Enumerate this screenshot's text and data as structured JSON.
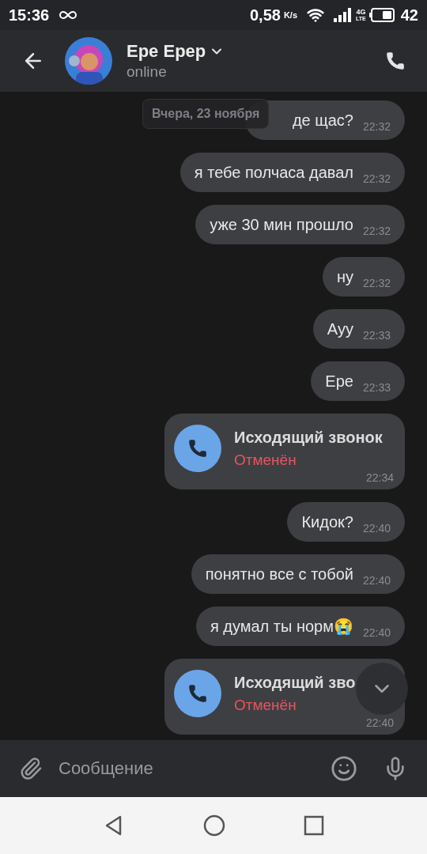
{
  "status_bar": {
    "time": "15:36",
    "speed": "0,58",
    "speed_unit": "K/s",
    "network": "4G",
    "network_sub": "LTE",
    "battery": "42"
  },
  "header": {
    "name": "Ере Ерер",
    "status": "online"
  },
  "date_pill": "Вчера, 23 ноября",
  "messages": [
    {
      "kind": "text",
      "text": "де щас?",
      "time": "22:32"
    },
    {
      "kind": "text",
      "text": "я тебе полчаса давал",
      "time": "22:32"
    },
    {
      "kind": "text",
      "text": "уже 30 мин прошло",
      "time": "22:32"
    },
    {
      "kind": "text",
      "text": "ну",
      "time": "22:32"
    },
    {
      "kind": "text",
      "text": "Ауу",
      "time": "22:33"
    },
    {
      "kind": "text",
      "text": "Ере",
      "time": "22:33"
    },
    {
      "kind": "call",
      "title": "Исходящий звонок",
      "status": "Отменён",
      "time": "22:34"
    },
    {
      "kind": "text",
      "text": "Кидок?",
      "time": "22:40"
    },
    {
      "kind": "text",
      "text": "понятно все с тобой",
      "time": "22:40"
    },
    {
      "kind": "text",
      "text": "я думал ты норм😭",
      "time": "22:40"
    },
    {
      "kind": "call",
      "title": "Исходящий зво",
      "status": "Отменён",
      "time": "22:40"
    }
  ],
  "composer": {
    "placeholder": "Сообщение"
  }
}
